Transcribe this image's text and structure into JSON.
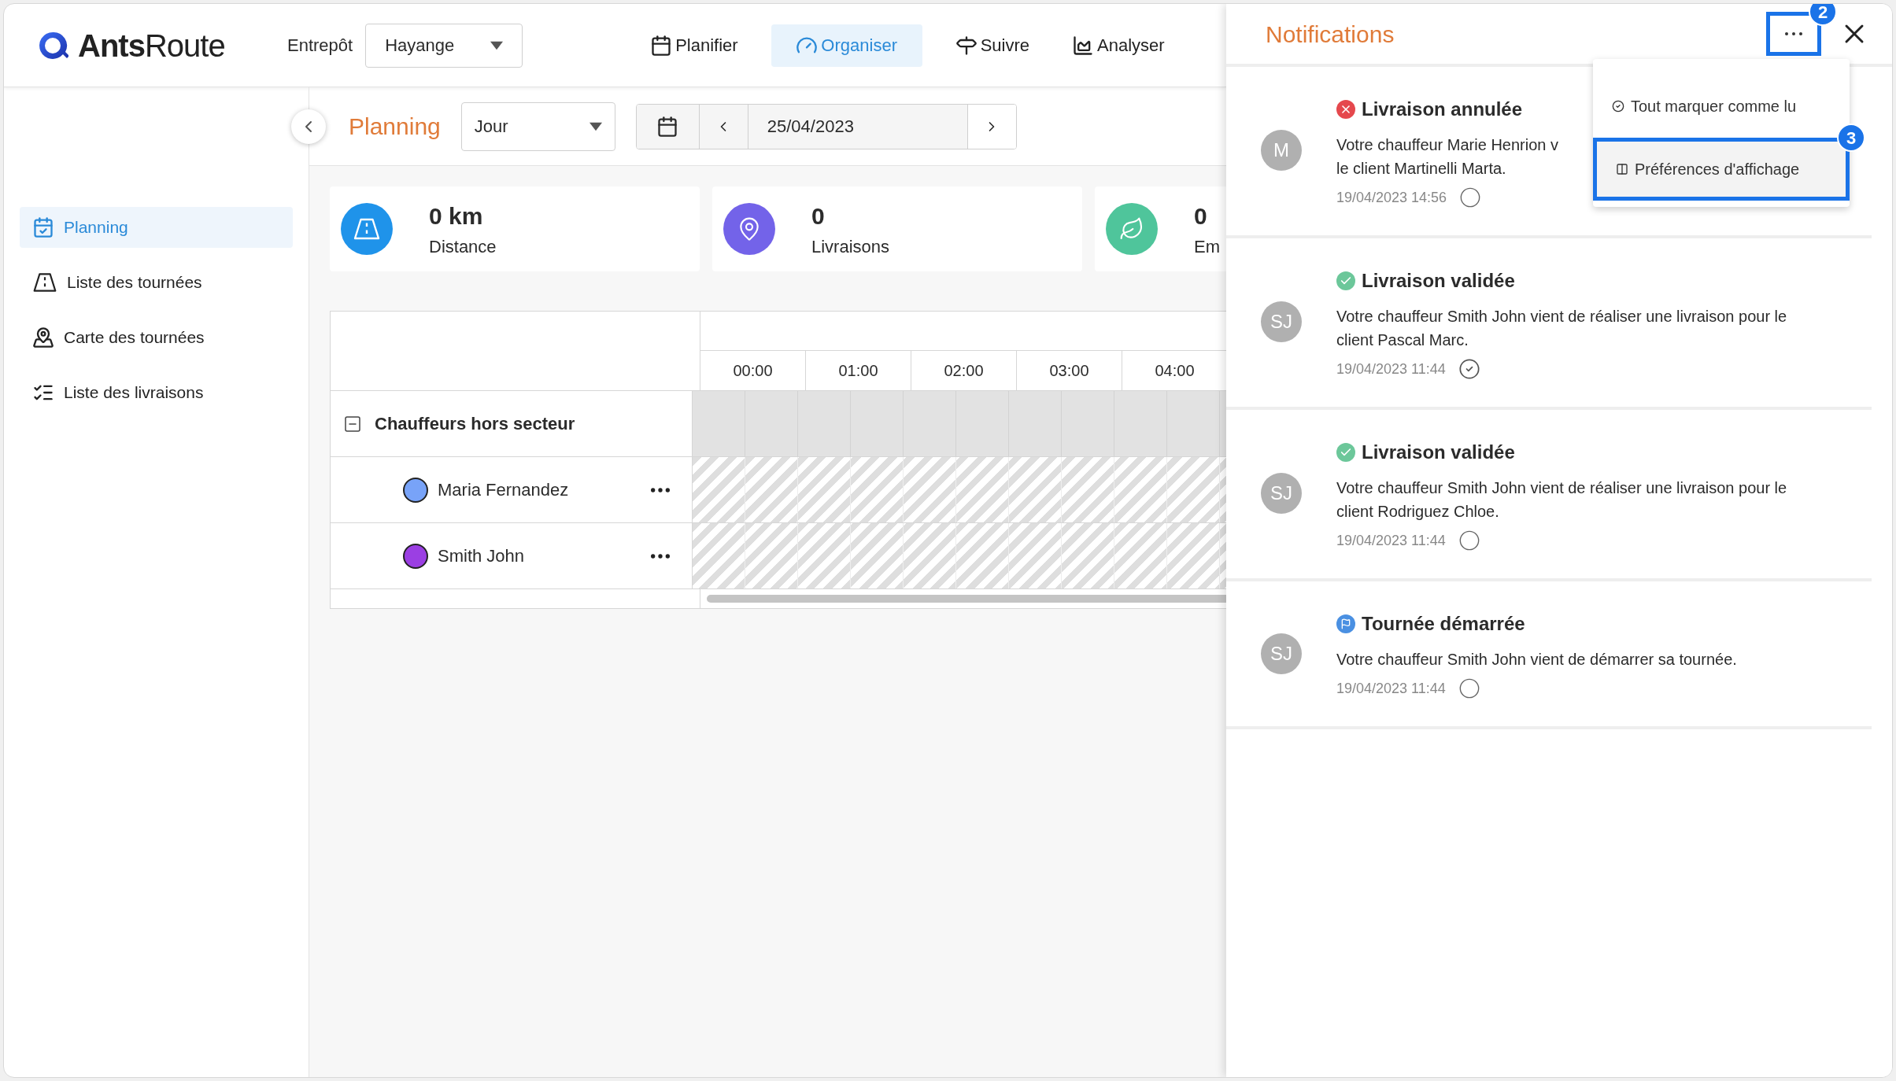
{
  "header": {
    "logo": "**Ants**Route",
    "warehouse_label": "Entrepôt",
    "warehouse_select": "Hayange",
    "nav": [
      {
        "label": "Planifier",
        "selected": false
      },
      {
        "label": "Organiser",
        "selected": true
      },
      {
        "label": "Suivre",
        "selected": false
      },
      {
        "label": "Analyser",
        "selected": false
      }
    ]
  },
  "sidebar": {
    "items": [
      {
        "label": "Planning",
        "selected": true
      },
      {
        "label": "Liste des tournées",
        "selected": false
      },
      {
        "label": "Carte des tournées",
        "selected": false
      },
      {
        "label": "Liste des livraisons",
        "selected": false
      }
    ]
  },
  "toolbar": {
    "title": "Planning",
    "view_select": "Jour",
    "date": "25/04/2023"
  },
  "stats": [
    {
      "value": "0 km",
      "label": "Distance",
      "color": "#1f93ea"
    },
    {
      "value": "0",
      "label": "Livraisons",
      "color": "#7363e9"
    },
    {
      "value": "0",
      "label": "Em",
      "color": "#4fc59b"
    }
  ],
  "schedule": {
    "hours": [
      "00:00",
      "01:00",
      "02:00",
      "03:00",
      "04:00"
    ],
    "groups": [
      {
        "label": "Chauffeurs hors secteur",
        "expanded": true,
        "drivers": [
          {
            "name": "Maria Fernandez",
            "color": "#78a3f8"
          },
          {
            "name": "Smith John",
            "color": "#9b3fe3"
          }
        ]
      }
    ]
  },
  "notifications": {
    "title": "Notifications",
    "menu_callout": "2",
    "menu": [
      {
        "label": "Tout marquer comme lu",
        "highlighted": false
      },
      {
        "label": "Préférences d'affichage",
        "highlighted": true,
        "callout": "3"
      }
    ],
    "items": [
      {
        "kind": "cancelled",
        "title": "Livraison annulée",
        "avatar": "M",
        "message_lines": [
          "Votre chauffeur Marie Henrion v",
          "le client Martinelli Marta."
        ],
        "time": "19/04/2023 14:56",
        "read": false
      },
      {
        "kind": "validated",
        "title": "Livraison validée",
        "avatar": "SJ",
        "message_lines": [
          "Votre chauffeur Smith John vient de réaliser une livraison pour le",
          "client Pascal Marc."
        ],
        "time": "19/04/2023 11:44",
        "read": true
      },
      {
        "kind": "validated",
        "title": "Livraison validée",
        "avatar": "SJ",
        "message_lines": [
          "Votre chauffeur Smith John vient de réaliser une livraison pour le",
          "client Rodriguez Chloe."
        ],
        "time": "19/04/2023 11:44",
        "read": false
      },
      {
        "kind": "started",
        "title": "Tournée démarrée",
        "avatar": "SJ",
        "message_lines": [
          "Votre chauffeur Smith John vient de démarrer sa tournée."
        ],
        "time": "19/04/2023 11:44",
        "read": false
      }
    ]
  }
}
